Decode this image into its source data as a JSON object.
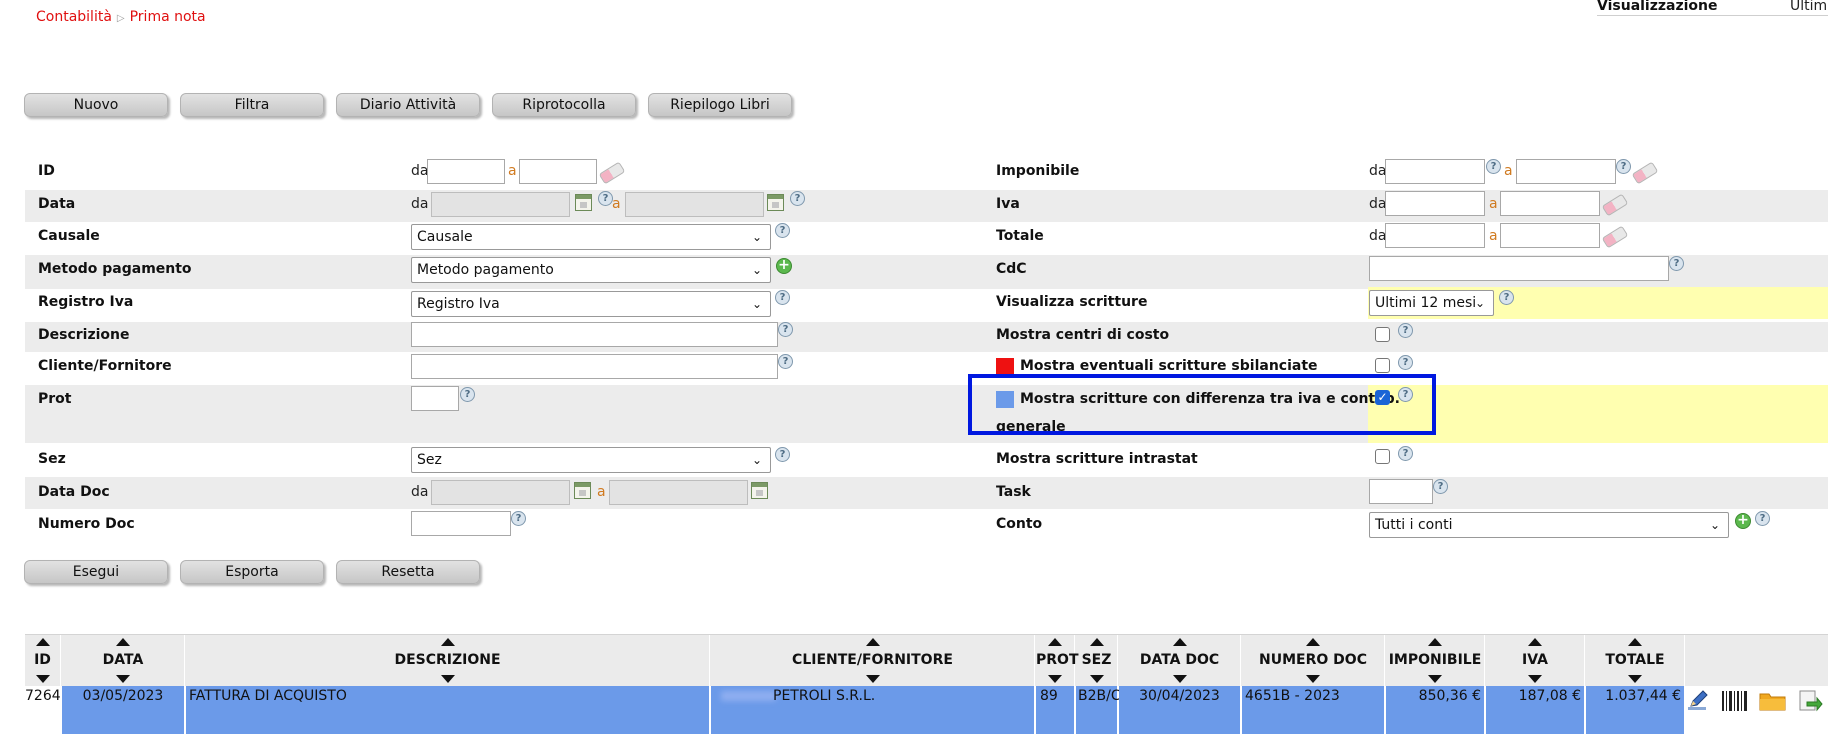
{
  "breadcrumb": {
    "root": "Contabilità",
    "current": "Prima nota"
  },
  "view": {
    "label": "Visualizzazione",
    "value": "Ultim"
  },
  "toolbar": {
    "nuovo": "Nuovo",
    "filtra": "Filtra",
    "diario": "Diario Attività",
    "riprotocolla": "Riprotocolla",
    "riepilogo": "Riepilogo Libri"
  },
  "common": {
    "da": "da",
    "a": "a"
  },
  "filters_left": {
    "id": "ID",
    "data": "Data",
    "causale": "Causale",
    "causale_value": "Causale",
    "metodo": "Metodo pagamento",
    "metodo_value": "Metodo pagamento",
    "registro": "Registro Iva",
    "registro_value": "Registro Iva",
    "descrizione": "Descrizione",
    "cliente": "Cliente/Fornitore",
    "prot": "Prot",
    "sez": "Sez",
    "sez_value": "Sez",
    "data_doc": "Data Doc",
    "numero_doc": "Numero Doc"
  },
  "filters_right": {
    "imponibile": "Imponibile",
    "iva": "Iva",
    "totale": "Totale",
    "cdc": "CdC",
    "visualizza": "Visualizza scritture",
    "visualizza_value": "Ultimi 12 mesi",
    "centri": "Mostra centri di costo",
    "sbilanciate": "Mostra eventuali scritture sbilanciate",
    "differenza_1": "Mostra scritture con differenza tra iva e contab.",
    "differenza_2": "generale",
    "intrastat": "Mostra scritture intrastat",
    "task": "Task",
    "conto": "Conto",
    "conto_value": "Tutti i conti"
  },
  "checks": {
    "centri": false,
    "sbilanciate": false,
    "differenza": true,
    "intrastat": false
  },
  "colors": {
    "sbilanciate_marker": "#ee1111",
    "differenza_marker": "#6b9ae9",
    "highlight": "#0018e0",
    "row_selected": "#6b9ae9"
  },
  "actions": {
    "esegui": "Esegui",
    "esporta": "Esporta",
    "resetta": "Resetta"
  },
  "table": {
    "columns": [
      "ID",
      "DATA",
      "DESCRIZIONE",
      "CLIENTE/FORNITORE",
      "PROT",
      "SEZ",
      "DATA DOC",
      "NUMERO DOC",
      "IMPONIBILE",
      "IVA",
      "TOTALE"
    ],
    "rows": [
      {
        "id": "7264",
        "data": "03/05/2023",
        "descrizione": "FATTURA DI ACQUISTO",
        "cliente": "PETROLI S.R.L.",
        "prot": "89",
        "sez": "B2B/C",
        "data_doc": "30/04/2023",
        "numero_doc": "4651B - 2023",
        "imponibile": "850,36 €",
        "iva": "187,08 €",
        "totale": "1.037,44 €"
      }
    ],
    "row_icons": [
      "edit-icon",
      "barcode-icon",
      "folder-icon",
      "export-icon"
    ]
  }
}
